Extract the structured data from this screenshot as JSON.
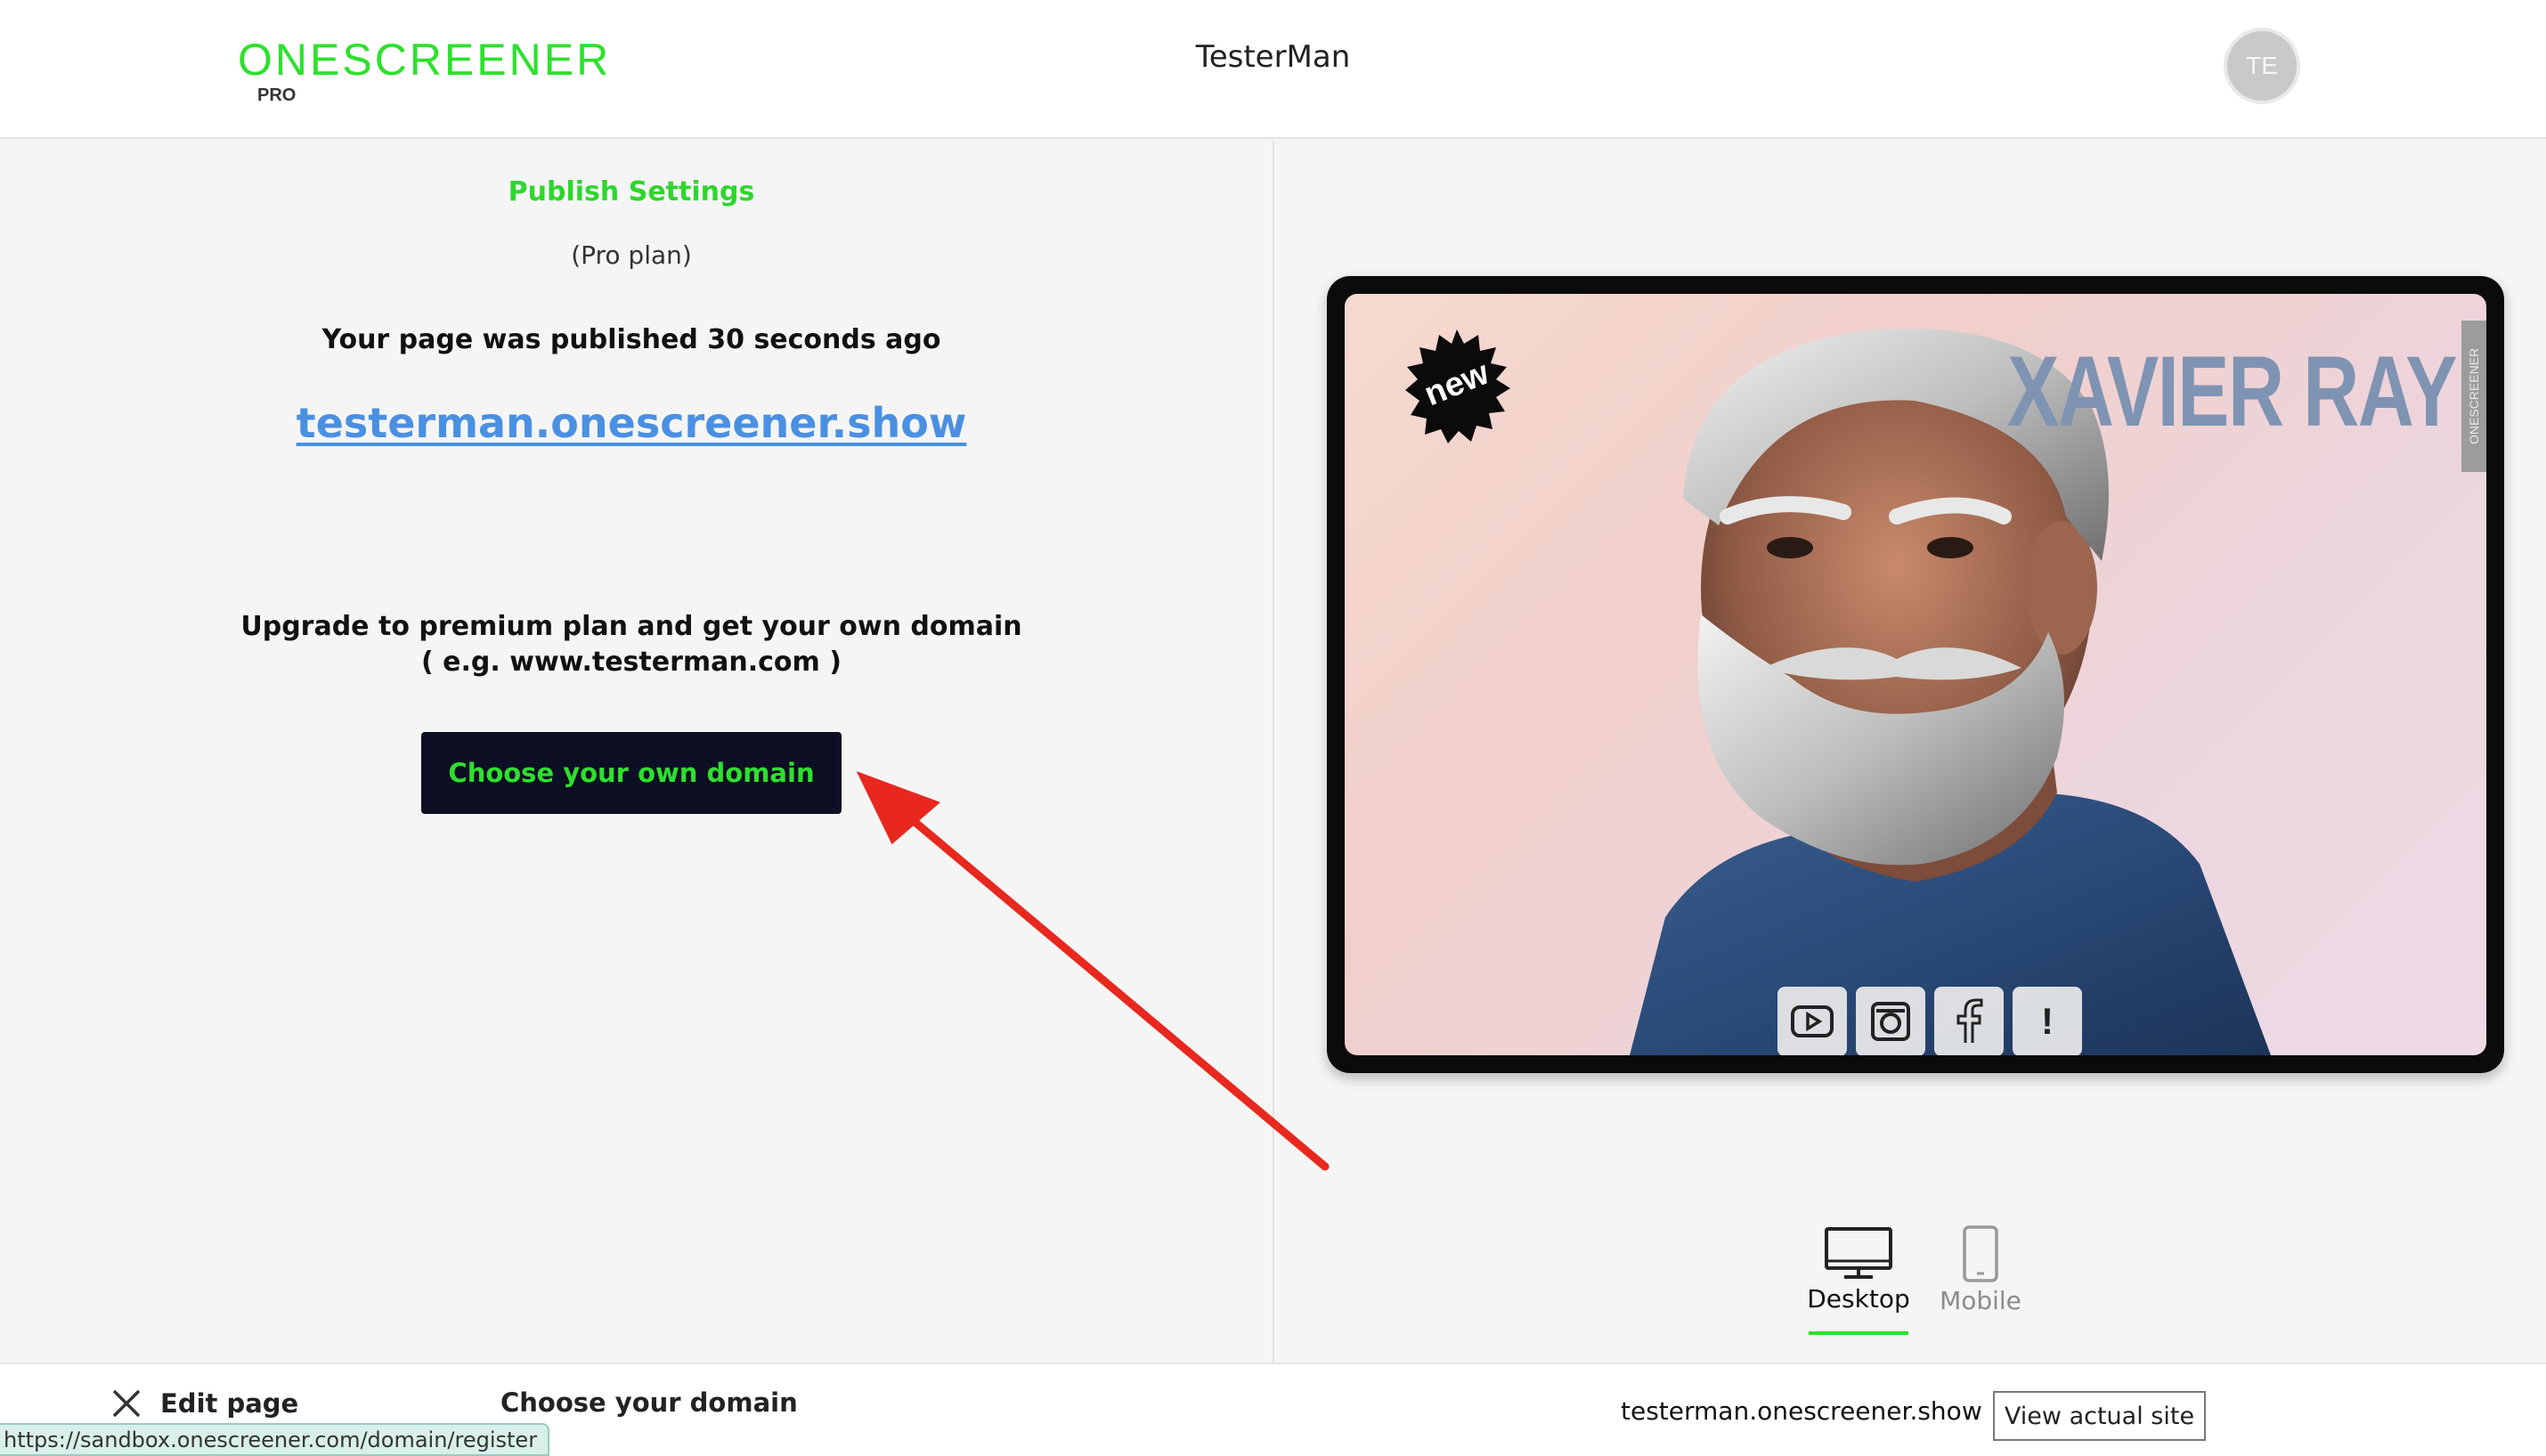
{
  "header": {
    "logo_main": "ONESCREENER",
    "logo_sub": "PRO",
    "title": "TesterMan",
    "avatar_initials": "TE"
  },
  "publish": {
    "heading": "Publish Settings",
    "plan": "(Pro plan)",
    "published_status": "Your page was published 30 seconds ago",
    "site_link": "testerman.onescreener.show",
    "upgrade_line1": "Upgrade to premium plan and get your own domain",
    "upgrade_line2": "( e.g. www.testerman.com )",
    "domain_button_label": "Choose your own domain"
  },
  "preview": {
    "artist_name": "XAVIER RAY",
    "badge_text": "new",
    "side_strip_text": "ONESCREENER",
    "social_icons": [
      "youtube-icon",
      "instagram-icon",
      "facebook-icon",
      "info-icon"
    ],
    "info_glyph": "!"
  },
  "view_switch": {
    "desktop_label": "Desktop",
    "mobile_label": "Mobile",
    "active": "Desktop"
  },
  "footer": {
    "edit_label": "Edit page",
    "choose_domain_label": "Choose your domain",
    "site_url": "testerman.onescreener.show",
    "view_site_label": "View actual site"
  },
  "status_bar": {
    "hover_url": "https://sandbox.onescreener.com/domain/register"
  },
  "colors": {
    "brand_green": "#2ee02e",
    "link_blue": "#4a90e2",
    "button_navy": "#0d0f24",
    "annotation_red": "#e8281e",
    "artist_name": "#7f93b3"
  }
}
